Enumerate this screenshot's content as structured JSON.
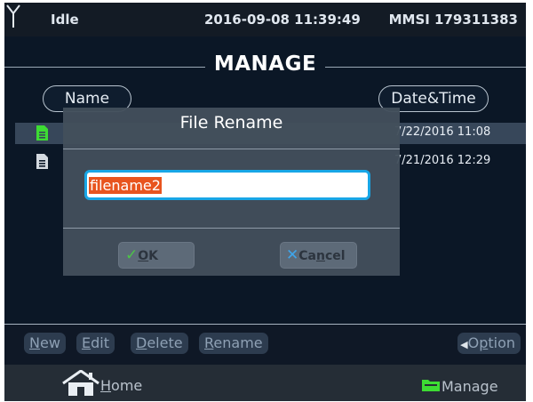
{
  "status_bar": {
    "status": "Idle",
    "datetime": "2016-09-08 11:39:49",
    "mmsi": "MMSI 179311383"
  },
  "page": {
    "title": "MANAGE"
  },
  "list": {
    "columns": [
      "Name",
      "Date&Time"
    ],
    "rows": [
      {
        "icon": "file-icon",
        "icon_color": "#3ddc33",
        "date": "7/22/2016 11:08",
        "selected": true
      },
      {
        "icon": "file-icon",
        "icon_color": "#d4dae0",
        "date": "7/21/2016 12:29",
        "selected": false
      }
    ]
  },
  "dialog": {
    "title": "File Rename",
    "input_value": "filename2",
    "ok_label": "OK",
    "ok_mnemonic": "O",
    "ok_rest": "K",
    "cancel_label": "Cancel",
    "cancel_pre": "Ca",
    "cancel_mnemonic": "n",
    "cancel_post": "cel",
    "icons": {
      "ok": "checkmark-icon",
      "cancel": "x-icon"
    }
  },
  "action_bar": {
    "new": {
      "label": "New",
      "mn": "N",
      "rest": "ew"
    },
    "edit": {
      "label": "Edit",
      "mn": "E",
      "rest": "dit"
    },
    "delete": {
      "label": "Delete",
      "mn": "D",
      "rest": "elete"
    },
    "rename": {
      "label": "Rename",
      "mn": "R",
      "rest": "ename"
    },
    "option": {
      "label": "Option",
      "pre": "O",
      "mn": "p",
      "rest": "tion"
    }
  },
  "nav": {
    "home": {
      "label": "Home",
      "mn": "H",
      "rest": "ome",
      "icon": "home-icon"
    },
    "manage": {
      "label": "Manage",
      "icon": "folder-icon",
      "icon_color": "#3ddc33"
    }
  },
  "colors": {
    "background": "#0b1726",
    "selected_row": "#37475a",
    "accent_blue": "#18a6e6",
    "selection_orange": "#e8541e"
  }
}
